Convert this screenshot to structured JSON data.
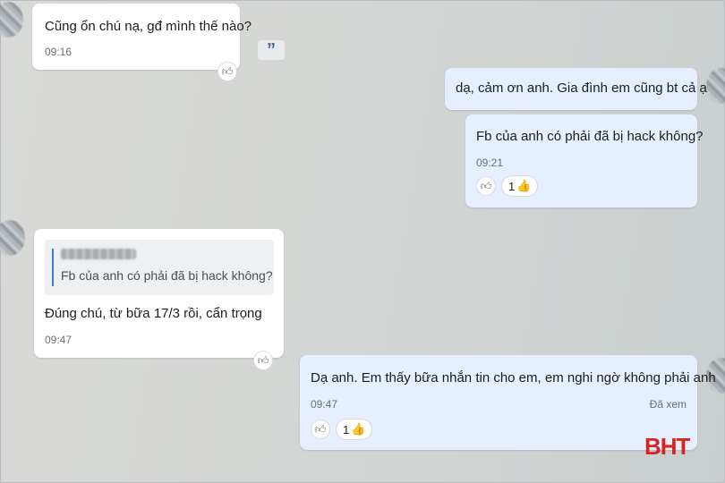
{
  "messages": [
    {
      "text": "Cũng ổn chú nạ, gđ mình thế nào?",
      "time": "09:16"
    },
    {
      "text": "dạ, cảm ơn anh. Gia đình em cũng bt cả ạ"
    },
    {
      "text": "Fb của anh có phải đã bị hack không?",
      "time": "09:21",
      "reaction_count": "1"
    },
    {
      "quote": "Fb của anh có phải đã bị hack không?",
      "text": "Đúng chú, từ bữa 17/3 rồi, cẩn trọng",
      "time": "09:47"
    },
    {
      "text": "Dạ anh. Em thấy bữa nhắn tin cho em, em nghi ngờ không phải anh",
      "time": "09:47",
      "status": "Đã xem",
      "reaction_count": "1"
    }
  ],
  "icons": {
    "quote_button": "quote-icon",
    "react": "thumbs-up-outline-icon",
    "reaction": "thumbs-up-emoji-icon"
  },
  "watermark": "BHT",
  "colors": {
    "incoming": "#ffffff",
    "outgoing": "#e5efff",
    "accent": "#3c78d8",
    "watermark": "#d9231d"
  }
}
